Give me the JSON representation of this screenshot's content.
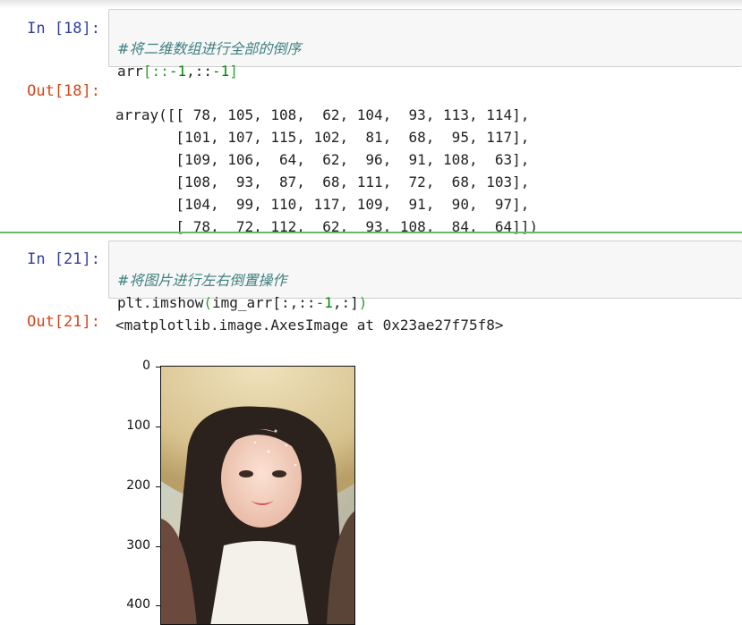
{
  "cell1": {
    "in_prompt": "In  [18]:",
    "comment": "#将二维数组进行全部的倒序",
    "code_arr": "arr",
    "code_slice_a": "[::",
    "code_m1a": "-1",
    "code_comma": ",::",
    "code_m1b": "-1",
    "code_close": "]",
    "out_prompt": "Out[18]:",
    "output_lines": [
      "array([[ 78, 105, 108,  62, 104,  93, 113, 114],",
      "       [101, 107, 115, 102,  81,  68,  95, 117],",
      "       [109, 106,  64,  62,  96,  91, 108,  63],",
      "       [108,  93,  87,  68, 111,  72,  68, 103],",
      "       [104,  99, 110, 117, 109,  91,  90,  97],",
      "       [ 78,  72, 112,  62,  93, 108,  84,  64]])"
    ]
  },
  "cell2": {
    "in_prompt": "In  [21]:",
    "comment": "#将图片进行左右倒置操作",
    "code_func": "plt.imshow",
    "code_open": "(",
    "code_arg": "img_arr[:,::",
    "code_m1": "-1",
    "code_rest": ",:]",
    "code_close": ")",
    "out_prompt": "Out[21]:",
    "output_text": "<matplotlib.image.AxesImage at 0x23ae27f75f8>"
  },
  "plot": {
    "y_ticks": [
      "0",
      "100",
      "200",
      "300",
      "400"
    ],
    "image_subject": "girl-in-straw-hat-photo"
  },
  "colors": {
    "in_prompt": "#303f9f",
    "out_prompt": "#d84315",
    "comment": "#408080",
    "selected_cell_bar": "#66bb6a"
  }
}
